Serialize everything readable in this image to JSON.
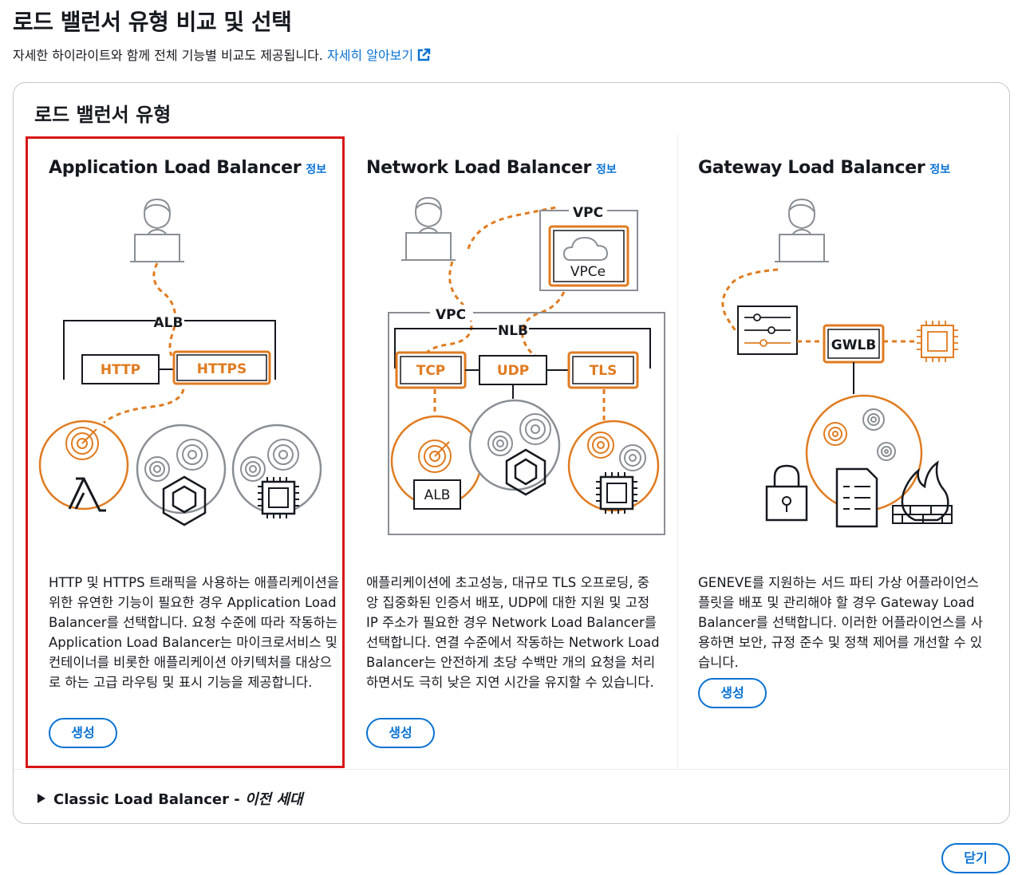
{
  "page": {
    "title": "로드 밸런서 유형 비교 및 선택",
    "subtitle": "자세한 하이라이트와 함께 전체 기능별 비교도 제공됩니다.",
    "learn_more": "자세히 알아보기"
  },
  "container": {
    "header": "로드 밸런서 유형"
  },
  "cards": [
    {
      "title": "Application Load Balancer",
      "info": "정보",
      "diagram": {
        "lb_label": "ALB",
        "proto_1": "HTTP",
        "proto_2": "HTTPS"
      },
      "description": "HTTP 및 HTTPS 트래픽을 사용하는 애플리케이션을 위한 유연한 기능이 필요한 경우 Application Load Balancer를 선택합니다. 요청 수준에 따라 작동하는 Application Load Balancer는 마이크로서비스 및 컨테이너를 비롯한 애플리케이션 아키텍처를 대상으로 하는 고급 라우팅 및 표시 기능을 제공합니다.",
      "button": "생성",
      "selected": true
    },
    {
      "title": "Network Load Balancer",
      "info": "정보",
      "diagram": {
        "vpc_top": "VPC",
        "vpce": "VPCe",
        "vpc_left": "VPC",
        "lb_label": "NLB",
        "proto_1": "TCP",
        "proto_2": "UDP",
        "proto_3": "TLS",
        "alb": "ALB"
      },
      "description": "애플리케이션에 초고성능, 대규모 TLS 오프로딩, 중앙 집중화된 인증서 배포, UDP에 대한 지원 및 고정 IP 주소가 필요한 경우 Network Load Balancer를 선택합니다. 연결 수준에서 작동하는 Network Load Balancer는 안전하게 초당 수백만 개의 요청을 처리하면서도 극히 낮은 지연 시간을 유지할 수 있습니다.",
      "button": "생성",
      "selected": false
    },
    {
      "title": "Gateway Load Balancer",
      "info": "정보",
      "diagram": {
        "lb_label": "GWLB"
      },
      "description": "GENEVE를 지원하는 서드 파티 가상 어플라이언스 플릿을 배포 및 관리해야 할 경우 Gateway Load Balancer를 선택합니다. 이러한 어플라이언스를 사용하면 보안, 규정 준수 및 정책 제어를 개선할 수 있습니다.",
      "button": "생성",
      "selected": false
    }
  ],
  "classic": {
    "label": "Classic Load Balancer - ",
    "suffix": "이전 세대"
  },
  "footer": {
    "close": "닫기"
  },
  "colors": {
    "accent_orange": "#e07b20",
    "link_blue": "#0972d3",
    "selected_red": "#d91515",
    "gray": "#8a8f95"
  }
}
